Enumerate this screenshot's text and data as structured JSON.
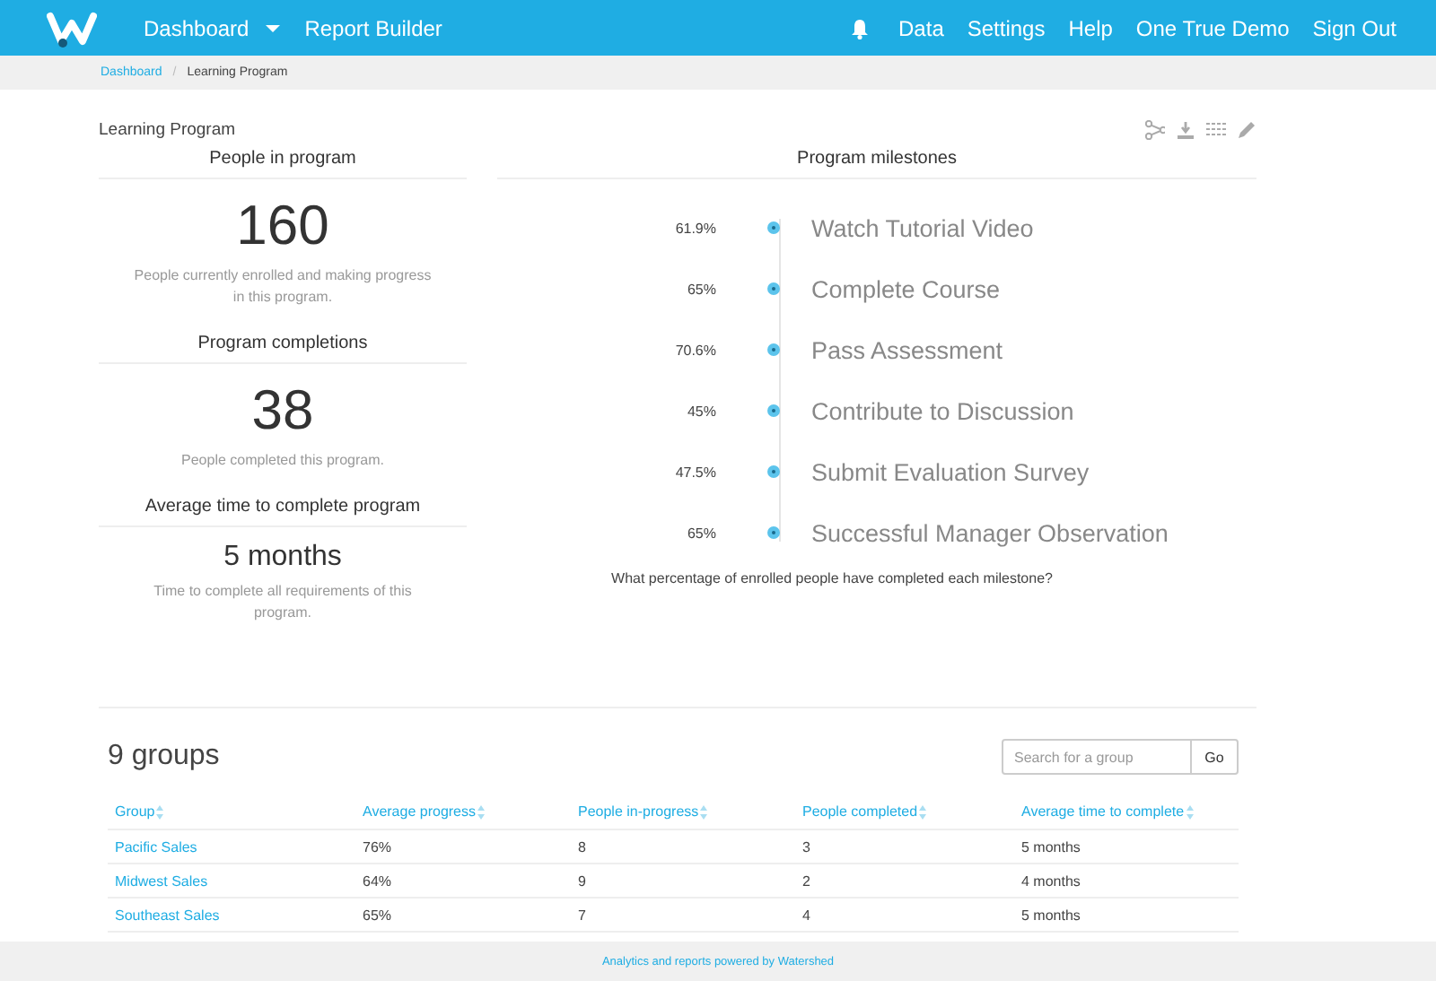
{
  "nav": {
    "left": [
      {
        "label": "Dashboard",
        "dropdown": true
      },
      {
        "label": "Report Builder",
        "dropdown": false
      }
    ],
    "right": [
      "Data",
      "Settings",
      "Help",
      "One True Demo",
      "Sign Out"
    ]
  },
  "breadcrumb": {
    "items": [
      "Dashboard",
      "Learning Program"
    ],
    "separator": "/"
  },
  "report": {
    "title": "Learning Program",
    "stats": [
      {
        "heading": "People in program",
        "value": "160",
        "kind": "count",
        "note": "People currently enrolled and making progress in this program."
      },
      {
        "heading": "Program completions",
        "value": "38",
        "kind": "count",
        "note": "People completed this program."
      },
      {
        "heading": "Average time to complete program",
        "value": "5 months",
        "kind": "duration",
        "note": "Time to complete all requirements of this program."
      }
    ],
    "milestones": {
      "heading": "Program milestones",
      "items": [
        {
          "percent": "61.9%",
          "label": "Watch Tutorial Video"
        },
        {
          "percent": "65%",
          "label": "Complete Course"
        },
        {
          "percent": "70.6%",
          "label": "Pass Assessment"
        },
        {
          "percent": "45%",
          "label": "Contribute to Discussion"
        },
        {
          "percent": "47.5%",
          "label": "Submit Evaluation Survey"
        },
        {
          "percent": "65%",
          "label": "Successful Manager Observation"
        }
      ],
      "caption": "What percentage of enrolled people have completed each milestone?"
    }
  },
  "groups": {
    "title": "9 groups",
    "search": {
      "placeholder": "Search for a group",
      "button": "Go"
    },
    "columns": [
      "Group",
      "Average progress",
      "People in-progress",
      "People completed",
      "Average time to complete"
    ],
    "rows": [
      [
        "Pacific Sales",
        "76%",
        "8",
        "3",
        "5 months"
      ],
      [
        "Midwest Sales",
        "64%",
        "9",
        "2",
        "4 months"
      ],
      [
        "Southeast Sales",
        "65%",
        "7",
        "4",
        "5 months"
      ]
    ]
  },
  "footer": "Analytics and reports powered by Watershed"
}
